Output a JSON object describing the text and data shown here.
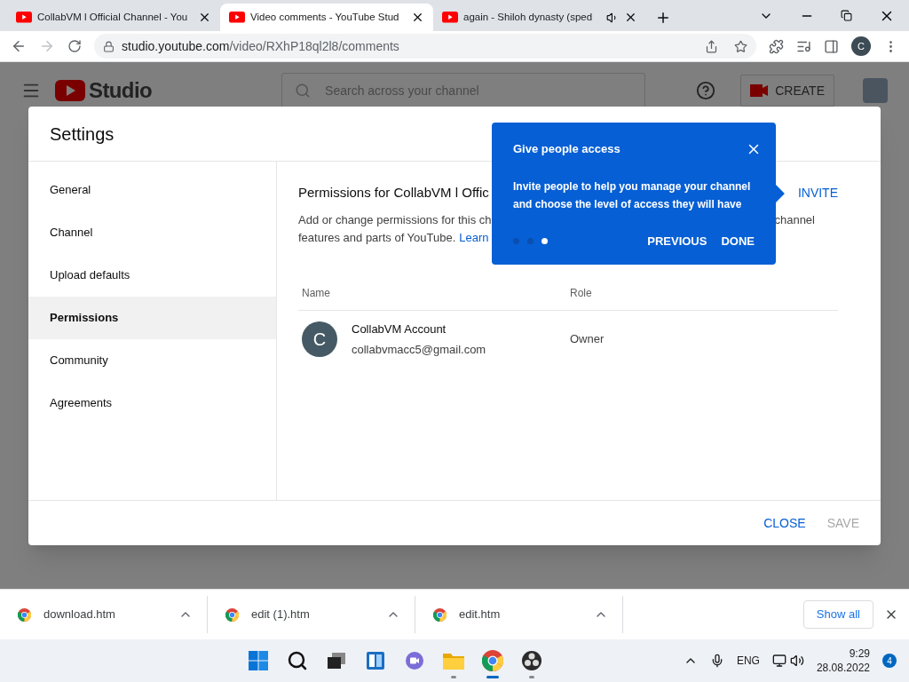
{
  "browser_tabs": [
    {
      "title": "CollabVM l Official Channel - You",
      "selected": false,
      "audio": false
    },
    {
      "title": "Video comments - YouTube Stud",
      "selected": true,
      "audio": false
    },
    {
      "title": "again - Shiloh dynasty (sped",
      "selected": false,
      "audio": true
    }
  ],
  "address_bar": {
    "host": "studio.youtube.com",
    "path": "/video/RXhP18ql2l8/comments",
    "profile_initial": "C"
  },
  "studio_header": {
    "logo": "Studio",
    "search_placeholder": "Search across your channel",
    "create_label": "CREATE"
  },
  "dialog": {
    "title": "Settings",
    "nav": [
      {
        "label": "General",
        "selected": false
      },
      {
        "label": "Channel",
        "selected": false
      },
      {
        "label": "Upload defaults",
        "selected": false
      },
      {
        "label": "Permissions",
        "selected": true
      },
      {
        "label": "Community",
        "selected": false
      },
      {
        "label": "Agreements",
        "selected": false
      }
    ],
    "heading": "Permissions for CollabVM l Offic",
    "invite_label": "INVITE",
    "description_line_1": "Add or change permissions for this ch",
    "description_line_1_end": "channel",
    "description_line_2": "features and parts of YouTube.",
    "learn_link": "Learn",
    "table": {
      "columns": [
        "Name",
        "Role"
      ],
      "rows": [
        {
          "initial": "C",
          "name": "CollabVM Account",
          "email": "collabvmacc5@gmail.com",
          "role": "Owner"
        }
      ]
    },
    "buttons": [
      {
        "label": "CLOSE",
        "disabled": false
      },
      {
        "label": "SAVE",
        "disabled": true
      }
    ]
  },
  "tip": {
    "title": "Give people access",
    "body": "Invite people to help you manage your channel and choose the level of access they will have",
    "steps": [
      {
        "selected": false
      },
      {
        "selected": false
      },
      {
        "selected": true
      }
    ],
    "previous_label": "PREVIOUS",
    "done_label": "DONE"
  },
  "downloads": [
    {
      "name": "download.htm"
    },
    {
      "name": "edit (1).htm"
    },
    {
      "name": "edit.htm"
    }
  ],
  "show_all_label": "Show all",
  "taskbar": {
    "apps": [
      {
        "kind": "start",
        "active": false
      },
      {
        "kind": "search",
        "active": false
      },
      {
        "kind": "taskview",
        "active": false
      },
      {
        "kind": "widgets",
        "active": false
      },
      {
        "kind": "chat",
        "active": false
      },
      {
        "kind": "explorer",
        "active": true
      },
      {
        "kind": "chrome",
        "active": true
      },
      {
        "kind": "obs",
        "active": true
      }
    ],
    "language": "ENG",
    "time": "9:29",
    "date": "28.08.2022",
    "notifications": "4"
  }
}
